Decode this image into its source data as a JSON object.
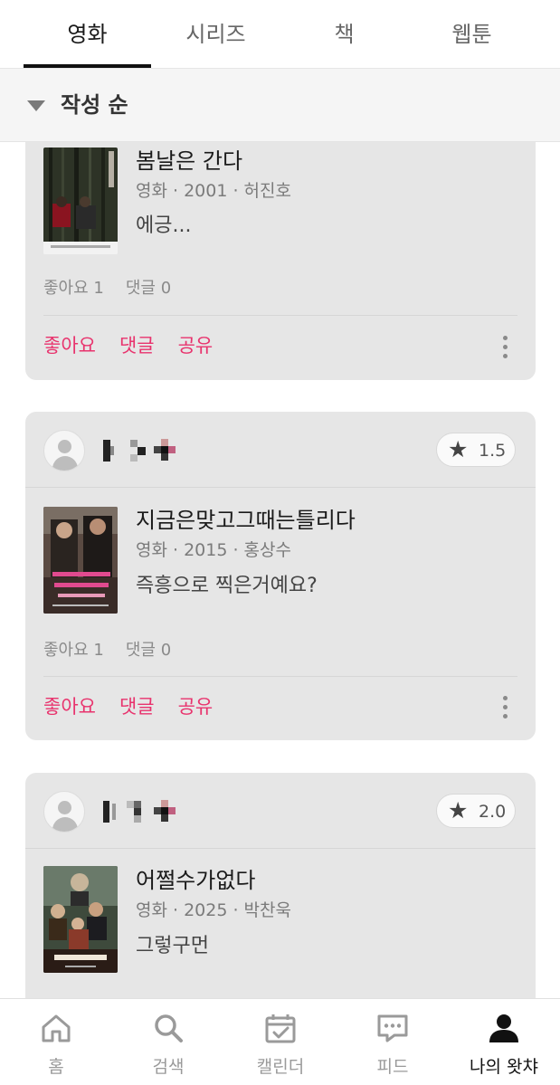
{
  "tabs": [
    {
      "label": "영화",
      "active": true
    },
    {
      "label": "시리즈",
      "active": false
    },
    {
      "label": "책",
      "active": false
    },
    {
      "label": "웹툰",
      "active": false
    }
  ],
  "sort": {
    "label": "작성 순",
    "icon": "triangle-down-icon"
  },
  "cards": [
    {
      "title": "봄날은 간다",
      "meta": "영화 · 2001 · 허진호",
      "comment": "에긍...",
      "likes": "좋아요 1",
      "comments": "댓글 0",
      "actions": {
        "like": "좋아요",
        "comment": "댓글",
        "share": "공유"
      }
    },
    {
      "rating": "1.5",
      "title": "지금은맞고그때는틀리다",
      "meta": "영화 · 2015 · 홍상수",
      "comment": "즉흥으로 찍은거예요?",
      "likes": "좋아요 1",
      "comments": "댓글 0",
      "actions": {
        "like": "좋아요",
        "comment": "댓글",
        "share": "공유"
      }
    },
    {
      "rating": "2.0",
      "title": "어쩔수가없다",
      "meta": "영화 · 2025 · 박찬욱",
      "comment": "그렇구먼"
    }
  ],
  "bottom_nav": [
    {
      "label": "홈",
      "icon": "home-icon",
      "active": false
    },
    {
      "label": "검색",
      "icon": "search-icon",
      "active": false
    },
    {
      "label": "캘린더",
      "icon": "calendar-icon",
      "active": false
    },
    {
      "label": "피드",
      "icon": "feed-chat-icon",
      "active": false
    },
    {
      "label": "나의 왓챠",
      "icon": "profile-icon",
      "active": true
    }
  ],
  "colors": {
    "accent": "#e8336d",
    "card_bg": "#e6e6e6",
    "sort_bg": "#f5f5f5"
  }
}
